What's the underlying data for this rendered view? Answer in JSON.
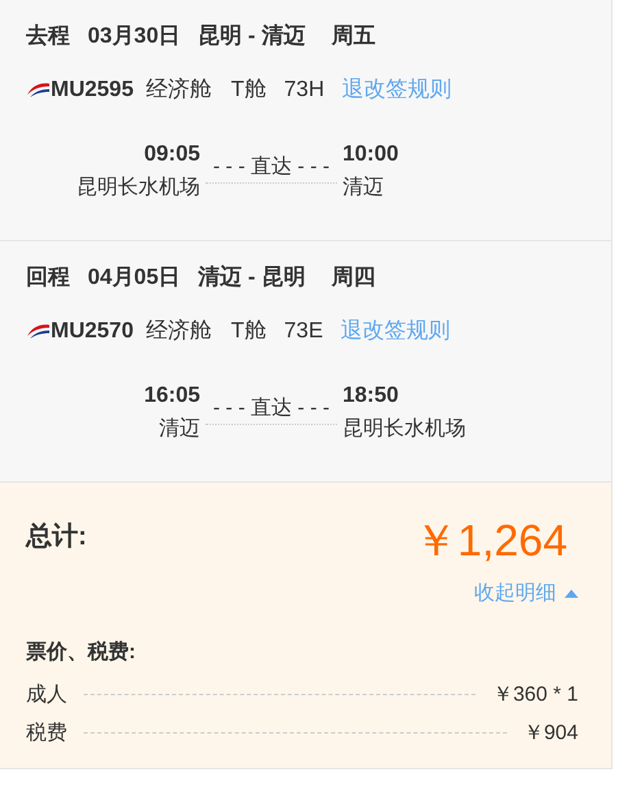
{
  "segments": [
    {
      "direction": "去程",
      "date": "03月30日",
      "route": "昆明 - 清迈",
      "weekday": "周五",
      "flight_no": "MU2595",
      "cabin_class": "经济舱",
      "cabin_code": "T舱",
      "aircraft": "73H",
      "rules_link": "退改签规则",
      "depart_time": "09:05",
      "depart_airport": "昆明长水机场",
      "connector": "- - - 直达 - - -",
      "arrive_time": "10:00",
      "arrive_airport": "清迈"
    },
    {
      "direction": "回程",
      "date": "04月05日",
      "route": "清迈 - 昆明",
      "weekday": "周四",
      "flight_no": "MU2570",
      "cabin_class": "经济舱",
      "cabin_code": "T舱",
      "aircraft": "73E",
      "rules_link": "退改签规则",
      "depart_time": "16:05",
      "depart_airport": "清迈",
      "connector": "- - - 直达 - - -",
      "arrive_time": "18:50",
      "arrive_airport": "昆明长水机场"
    }
  ],
  "total": {
    "label": "总计:",
    "amount": "￥1,264"
  },
  "details_toggle": {
    "label": "收起明细",
    "expanded": true
  },
  "breakdown": {
    "title": "票价、税费:",
    "rows": [
      {
        "label": "成人",
        "value": "￥360 * 1"
      },
      {
        "label": "税费",
        "value": "￥904"
      }
    ]
  }
}
